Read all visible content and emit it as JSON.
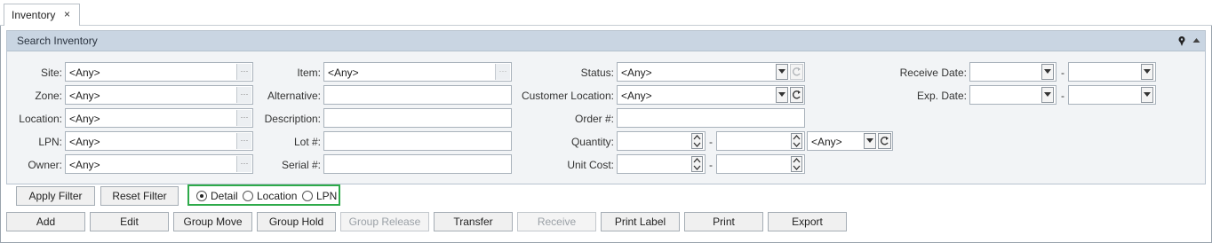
{
  "tab": {
    "label": "Inventory",
    "close": "×"
  },
  "panel": {
    "title": "Search Inventory"
  },
  "fields": {
    "site": {
      "label": "Site:",
      "value": "<Any>"
    },
    "zone": {
      "label": "Zone:",
      "value": "<Any>"
    },
    "location": {
      "label": "Location:",
      "value": "<Any>"
    },
    "lpn": {
      "label": "LPN:",
      "value": "<Any>"
    },
    "owner": {
      "label": "Owner:",
      "value": "<Any>"
    },
    "item": {
      "label": "Item:",
      "value": "<Any>"
    },
    "alternative": {
      "label": "Alternative:",
      "value": ""
    },
    "description": {
      "label": "Description:",
      "value": ""
    },
    "lot": {
      "label": "Lot #:",
      "value": ""
    },
    "serial": {
      "label": "Serial #:",
      "value": ""
    },
    "status": {
      "label": "Status:",
      "value": "<Any>"
    },
    "customer_location": {
      "label": "Customer Location:",
      "value": "<Any>"
    },
    "order": {
      "label": "Order #:",
      "value": ""
    },
    "quantity": {
      "label": "Quantity:",
      "from": "",
      "to": "",
      "unit": "<Any>",
      "separator": "-"
    },
    "unit_cost": {
      "label": "Unit Cost:",
      "from": "",
      "to": "",
      "separator": "-"
    },
    "receive_date": {
      "label": "Receive Date:",
      "from": "",
      "to": "",
      "separator": "-"
    },
    "exp_date": {
      "label": "Exp. Date:",
      "from": "",
      "to": "",
      "separator": "-"
    }
  },
  "filter_buttons": {
    "apply": "Apply Filter",
    "reset": "Reset Filter"
  },
  "view_mode": {
    "options": [
      "Detail",
      "Location",
      "LPN"
    ],
    "selected": "Detail"
  },
  "actions": [
    {
      "label": "Add",
      "enabled": true
    },
    {
      "label": "Edit",
      "enabled": true
    },
    {
      "label": "Group Move",
      "enabled": true
    },
    {
      "label": "Group Hold",
      "enabled": true
    },
    {
      "label": "Group Release",
      "enabled": false
    },
    {
      "label": "Transfer",
      "enabled": true
    },
    {
      "label": "Receive",
      "enabled": false
    },
    {
      "label": "Print Label",
      "enabled": true
    },
    {
      "label": "Print",
      "enabled": true
    },
    {
      "label": "Export",
      "enabled": true
    }
  ],
  "icons": {
    "tab_close": "close-icon",
    "panel_pin": "pin-icon",
    "panel_collapse": "chevron-up-icon",
    "lookup": "ellipsis-icon",
    "dropdown": "chevron-down-icon",
    "refresh": "refresh-icon",
    "spinner": "spinner-arrows-icon"
  },
  "colors": {
    "panel_header": "#c9d5e2",
    "panel_body": "#f2f4f6",
    "highlight_border": "#2eaa4a"
  }
}
